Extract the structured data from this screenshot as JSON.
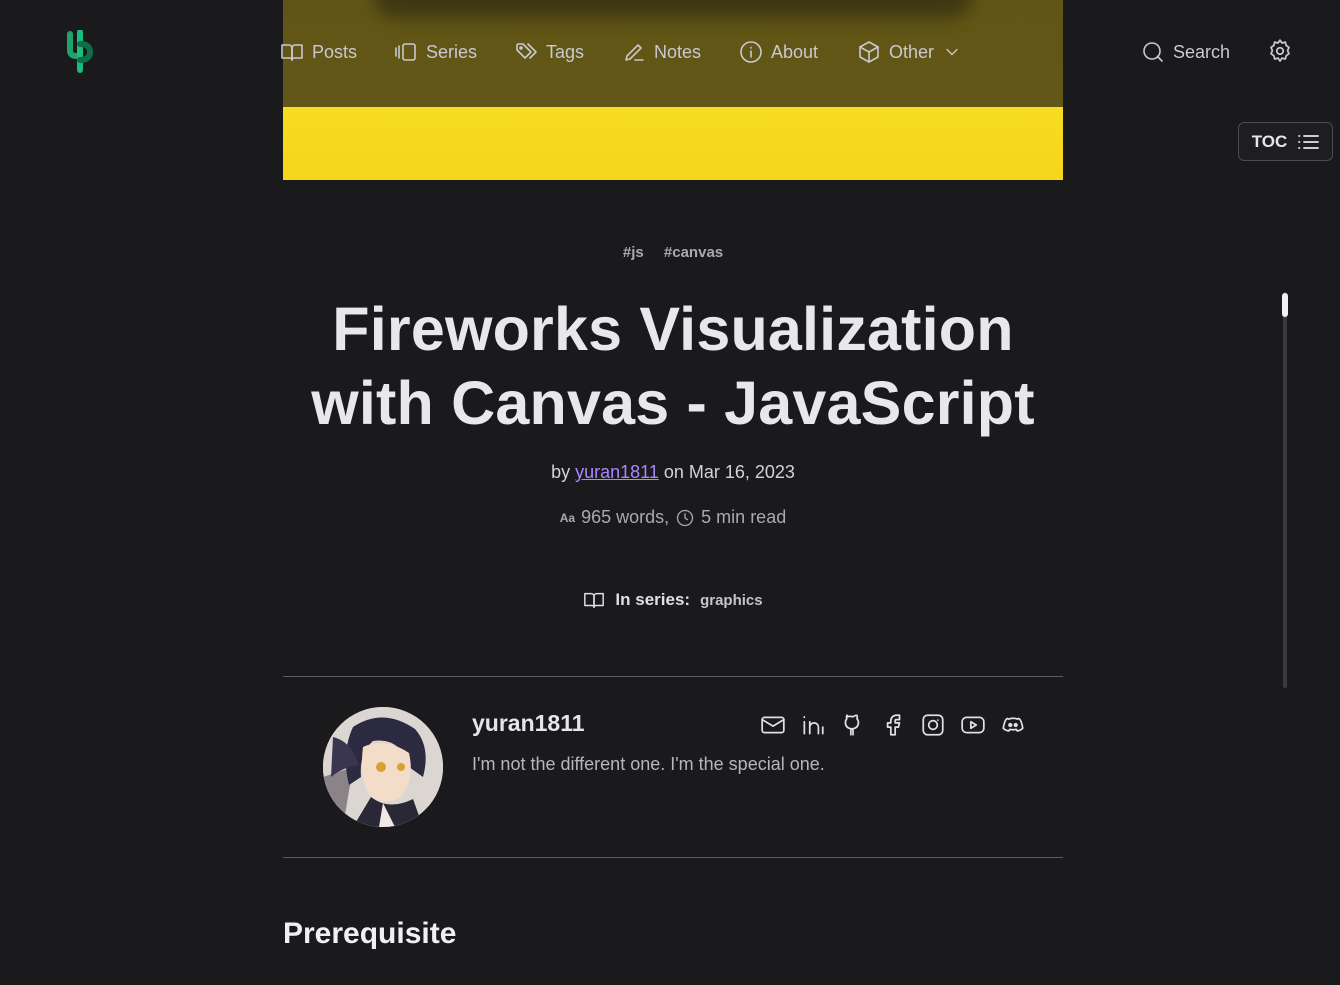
{
  "nav": {
    "items": [
      {
        "label": "Posts",
        "icon": "book-open-icon"
      },
      {
        "label": "Series",
        "icon": "series-icon"
      },
      {
        "label": "Tags",
        "icon": "tags-icon"
      },
      {
        "label": "Notes",
        "icon": "pencil-icon"
      },
      {
        "label": "About",
        "icon": "info-icon"
      },
      {
        "label": "Other",
        "icon": "box-icon"
      }
    ],
    "search_label": "Search"
  },
  "toc": {
    "label": "TOC"
  },
  "post": {
    "tags": [
      "#js",
      "#canvas"
    ],
    "title": "Fireworks Visualization with Canvas - JavaScript",
    "by_prefix": "by",
    "author": "yuran1811",
    "date_text": "on Mar 16, 2023",
    "words_icon": "Aa",
    "words": "965 words,",
    "read_time": "5 min read",
    "series_label": "In series:",
    "series_name": "graphics"
  },
  "author_card": {
    "name": "yuran1811",
    "bio": "I'm not the different one. I'm the special one.",
    "socials": [
      "mail-icon",
      "linkedin-icon",
      "github-icon",
      "facebook-icon",
      "instagram-icon",
      "youtube-icon",
      "discord-icon"
    ]
  },
  "content": {
    "first_heading": "Prerequisite"
  },
  "colors": {
    "background": "#1a1a1d",
    "accent_link": "#a887ff",
    "hero_yellow": "#f5d61c",
    "logo_green": "#1fa36a"
  }
}
